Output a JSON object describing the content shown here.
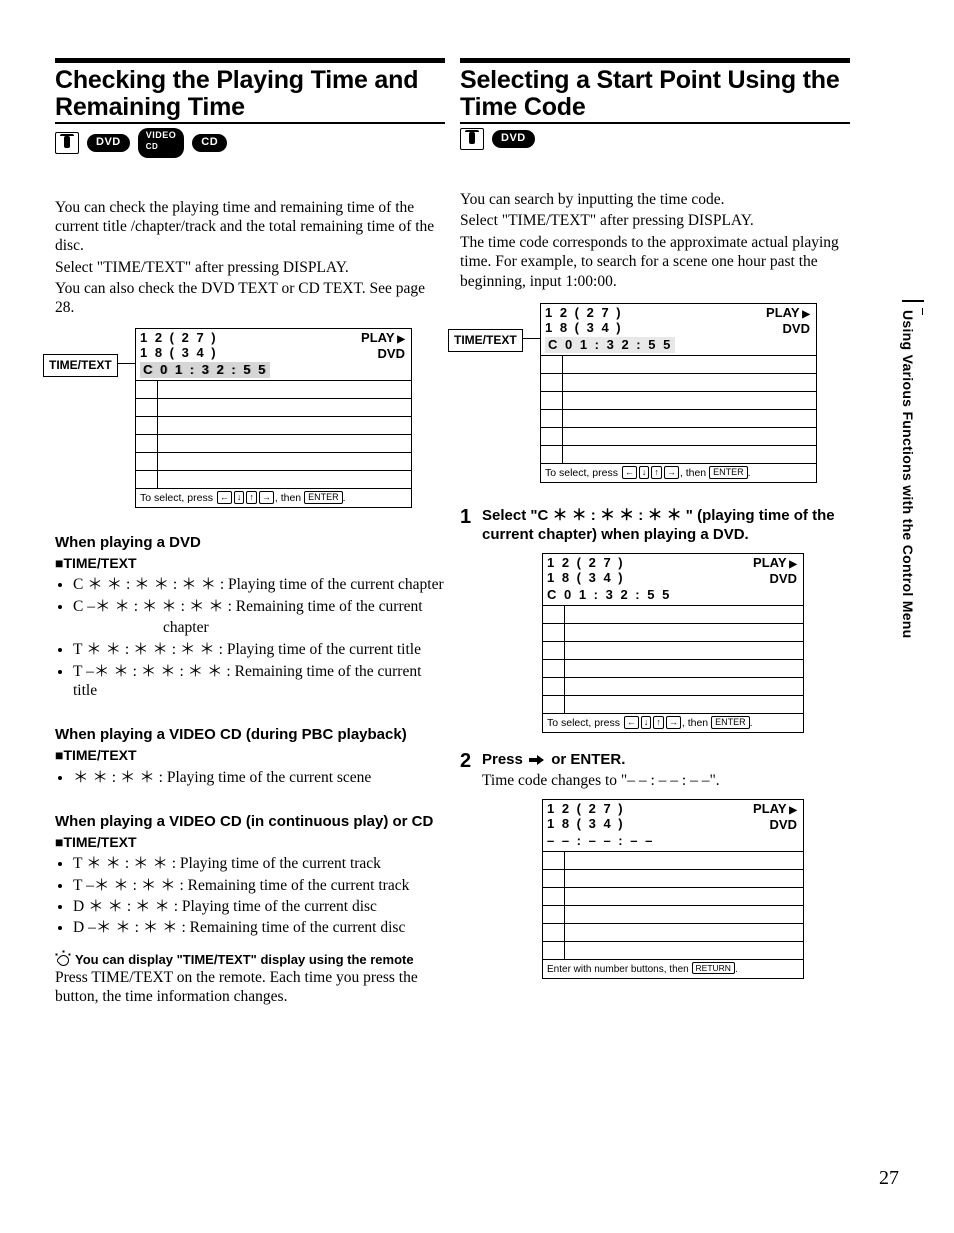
{
  "sideLabel": "Using Various Functions with the Control Menu",
  "pageNumber": "27",
  "left": {
    "title": "Checking the Playing Time and Remaining Time",
    "badges": [
      "DVD",
      "VIDEO CD",
      "CD"
    ],
    "intro": [
      "You can check the playing time and remaining time of the current title /chapter/track and the total remaining time of the disc.",
      "Select \"TIME/TEXT\" after pressing DISPLAY.",
      "You can also check the DVD TEXT or CD TEXT.  See page 28."
    ],
    "osd1": {
      "label": "TIME/TEXT",
      "line1": "1 2 ( 2 7 )",
      "line2": "1 8 ( 3 4 )",
      "line3": "C  0 1 : 3 2 : 5 5",
      "status1": "PLAY",
      "status2": "DVD",
      "footer": "To select, press",
      "footer_end": ", then",
      "enter": "ENTER"
    },
    "dvd": {
      "heading": "When playing a DVD",
      "tt": "■TIME/TEXT",
      "items": [
        "C   ＊ ＊ : ＊ ＊ : ＊ ＊ : Playing time of the current chapter",
        "C –＊ ＊ : ＊ ＊ : ＊ ＊ : Remaining time of the current",
        "chapter",
        "T   ＊ ＊ : ＊ ＊ : ＊ ＊ : Playing time of the current title",
        "T –＊ ＊ : ＊ ＊ : ＊ ＊ : Remaining time of the current title"
      ]
    },
    "vcd_pbc": {
      "heading": "When playing a VIDEO CD (during PBC playback)",
      "tt": "■TIME/TEXT",
      "items": [
        "＊ ＊ : ＊ ＊ : Playing time of the current scene"
      ]
    },
    "vcd_cont": {
      "heading": "When playing a VIDEO CD (in continuous play) or CD",
      "tt": "■TIME/TEXT",
      "items": [
        "T   ＊ ＊ : ＊ ＊ : Playing time of the current track",
        "T –＊ ＊ : ＊ ＊ : Remaining time of the current track",
        "D   ＊ ＊ : ＊ ＊ : Playing time of the current disc",
        "D –＊ ＊ : ＊ ＊ : Remaining time of the current disc"
      ]
    },
    "tip": {
      "head": "You can display \"TIME/TEXT\" display using the remote",
      "body": "Press TIME/TEXT on the remote.  Each time you press the button, the time information changes."
    }
  },
  "right": {
    "title": "Selecting a Start Point Using the Time Code",
    "badges": [
      "DVD"
    ],
    "intro": [
      "You can search by inputting the time code.",
      "Select \"TIME/TEXT\" after pressing DISPLAY.",
      "The time code corresponds to the approximate actual playing time. For example, to search for a scene one hour past the beginning, input 1:00:00."
    ],
    "osd1": {
      "label": "TIME/TEXT",
      "line1": "1 2 ( 2 7 )",
      "line2": "1 8 ( 3 4 )",
      "line3": "C   0 1 : 3 2 : 5 5",
      "status1": "PLAY",
      "status2": "DVD",
      "footer": "To select, press",
      "footer_end": ", then",
      "enter": "ENTER"
    },
    "step1": {
      "lead": "Select \"C ＊ ＊ : ＊ ＊ : ＊ ＊ \" (playing time of the current chapter) when playing a DVD.",
      "osd": {
        "line1": "1 2 ( 2 7 )",
        "line2": "1 8 ( 3 4 )",
        "line3": "C   0 1 : 3 2 : 5 5",
        "status1": "PLAY",
        "status2": "DVD",
        "footer": "To select, press",
        "footer_end": ", then",
        "enter": "ENTER"
      }
    },
    "step2": {
      "lead1": "Press",
      "lead2": "or ENTER.",
      "sub": "Time code changes to \"– – : – – : – –\".",
      "osd": {
        "line1": "1 2 ( 2 7 )",
        "line2": "1 8 ( 3 4 )",
        "line3": "   – – : – – : – –",
        "status1": "PLAY",
        "status2": "DVD",
        "footer": "Enter with number buttons, then",
        "enter": "RETURN"
      }
    }
  }
}
